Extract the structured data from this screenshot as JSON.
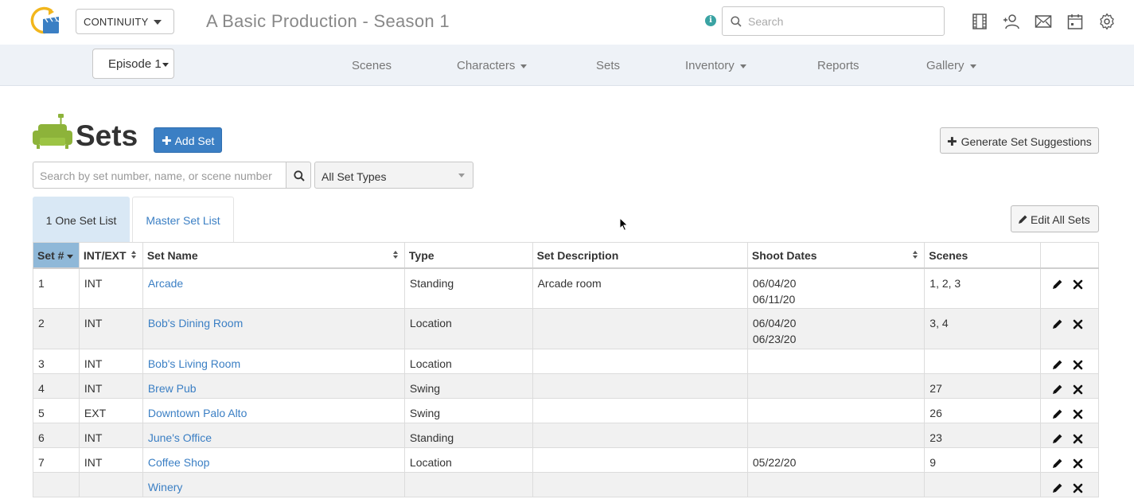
{
  "header": {
    "module": "CONTINUITY",
    "production_title": "A Basic Production - Season 1",
    "search_placeholder": "Search"
  },
  "nav": {
    "episode": "Episode 1",
    "items": [
      {
        "label": "Scenes",
        "dropdown": false
      },
      {
        "label": "Characters",
        "dropdown": true
      },
      {
        "label": "Sets",
        "dropdown": false
      },
      {
        "label": "Inventory",
        "dropdown": true
      },
      {
        "label": "Reports",
        "dropdown": false
      },
      {
        "label": "Gallery",
        "dropdown": true
      }
    ]
  },
  "page": {
    "title": "Sets",
    "add_button": "Add Set",
    "generate_button": "Generate Set Suggestions",
    "filter_placeholder": "Search by set number, name, or scene number",
    "type_filter": "All Set Types",
    "tabs": [
      "1 One Set List",
      "Master Set List"
    ],
    "edit_all_button": "Edit All Sets"
  },
  "table": {
    "columns": [
      "Set #",
      "INT/EXT",
      "Set Name",
      "Type",
      "Set Description",
      "Shoot Dates",
      "Scenes"
    ],
    "rows": [
      {
        "num": "1",
        "intext": "INT",
        "name": "Arcade",
        "type": "Standing",
        "desc": "Arcade room",
        "dates": [
          "06/04/20",
          "06/11/20"
        ],
        "scenes": "1, 2, 3"
      },
      {
        "num": "2",
        "intext": "INT",
        "name": "Bob's Dining Room",
        "type": "Location",
        "desc": "",
        "dates": [
          "06/04/20",
          "06/23/20"
        ],
        "scenes": "3, 4"
      },
      {
        "num": "3",
        "intext": "INT",
        "name": "Bob's Living Room",
        "type": "Location",
        "desc": "",
        "dates": [],
        "scenes": ""
      },
      {
        "num": "4",
        "intext": "INT",
        "name": "Brew Pub",
        "type": "Swing",
        "desc": "",
        "dates": [],
        "scenes": "27"
      },
      {
        "num": "5",
        "intext": "EXT",
        "name": "Downtown Palo Alto",
        "type": "Swing",
        "desc": "",
        "dates": [],
        "scenes": "26"
      },
      {
        "num": "6",
        "intext": "INT",
        "name": "June's Office",
        "type": "Standing",
        "desc": "",
        "dates": [],
        "scenes": "23"
      },
      {
        "num": "7",
        "intext": "INT",
        "name": "Coffee Shop",
        "type": "Location",
        "desc": "",
        "dates": [
          "05/22/20"
        ],
        "scenes": "9"
      },
      {
        "num": "",
        "intext": "",
        "name": "Winery",
        "type": "",
        "desc": "",
        "dates": [],
        "scenes": ""
      }
    ]
  },
  "colors": {
    "primary": "#3b7fc4",
    "sorted_header": "#8fb8d8",
    "active_tab": "#d9e8f5",
    "sets_icon": "#8db33a"
  }
}
